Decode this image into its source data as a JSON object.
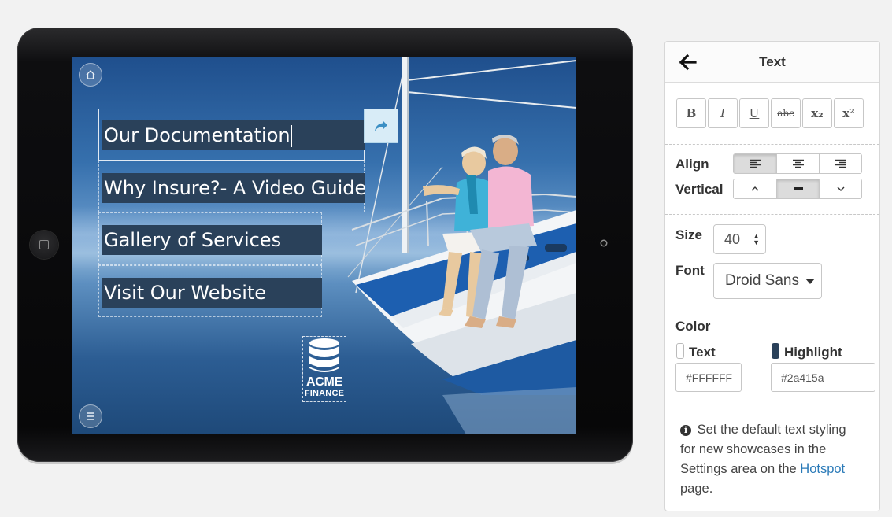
{
  "showcase": {
    "menu_items": [
      "Our Documentation",
      "Why Insure?- A Video Guide",
      "Gallery of Services",
      "Visit Our Website"
    ],
    "logo": {
      "line1": "ACME",
      "line2": "FINANCE"
    },
    "icons": [
      "home-icon",
      "menu-icon",
      "share-arrow-icon",
      "database-icon"
    ]
  },
  "panel": {
    "title": "Text",
    "format_buttons": [
      "B",
      "I",
      "U",
      "abc",
      "x₂",
      "x²"
    ],
    "align_label": "Align",
    "vertical_label": "Vertical",
    "align_selected": "left",
    "vertical_selected": "middle",
    "size_label": "Size",
    "size_value": "40",
    "font_label": "Font",
    "font_value": "Droid Sans",
    "color_label": "Color",
    "text_color_label": "Text",
    "text_color_value": "#FFFFFF",
    "highlight_label": "Highlight",
    "highlight_value": "#2a415a",
    "info_text_before": "Set the default text styling for new showcases in the Settings area on the",
    "info_link": "Hotspot",
    "info_text_after": "page."
  }
}
